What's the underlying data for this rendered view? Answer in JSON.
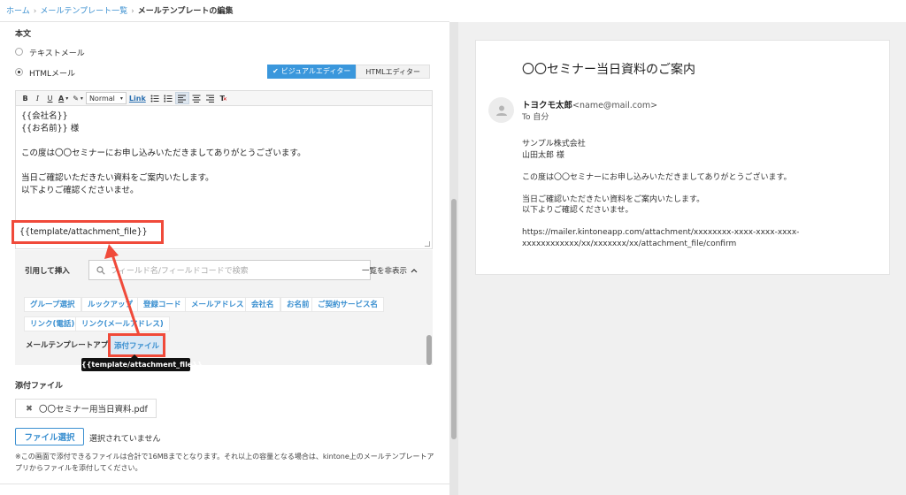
{
  "breadcrumb": {
    "home": "ホーム",
    "list": "メールテンプレート一覧",
    "current": "メールテンプレートの編集"
  },
  "body_section": {
    "label": "本文",
    "radio_text": "テキストメール",
    "radio_html": "HTMLメール",
    "selected": "HTMLメール",
    "tab_visual": "ビジュアルエディター",
    "tab_html": "HTMLエディター",
    "toolbar": {
      "bold": "B",
      "italic": "I",
      "underline": "U",
      "font_color": "A",
      "format": "Normal",
      "link": "Link",
      "clear": "T"
    },
    "editor_lines": [
      "{{会社名}}",
      "{{お名前}} 様",
      "",
      "この度は〇〇セミナーにお申し込みいただきましてありがとうございます。",
      "",
      "当日ご確認いただきたい資料をご案内いたします。",
      "以下よりご確認くださいませ。"
    ],
    "placeholder": "{{template/attachment_file}}"
  },
  "insert_panel": {
    "title": "引用して挿入",
    "search_placeholder": "フィールド名/フィールドコードで検索",
    "toggle_label": "一覧を非表示",
    "chips": [
      "グループ選択",
      "ルックアップ",
      "登録コード",
      "メールアドレス",
      "会社名",
      "お名前",
      "ご契約サービス名",
      "リンク(電話)",
      "リンク(メールアドレス)"
    ],
    "mail_template_label": "メールテンプレートアプリ",
    "attachment_chip": "添付ファイル",
    "tooltip": "{{template/attachment_file}}"
  },
  "attachment": {
    "label": "添付ファイル",
    "file_name": "〇〇セミナー用当日資料.pdf",
    "select_button": "ファイル選択",
    "status": "選択されていません",
    "note_line1": "※この画面で添付できるファイルは合計で16MBまでとなります。それ以上の容量となる場合は、kintone上のメールテンプレートア",
    "note_line2": "プリからファイルを添付してください。"
  },
  "preview": {
    "subject": "〇〇セミナー当日資料のご案内",
    "sender_name": "トヨクモ太郎",
    "sender_email": "<name@mail.com>",
    "to": "To 自分",
    "body_lines": [
      "サンプル株式会社",
      "山田太郎 様",
      "",
      "この度は〇〇セミナーにお申し込みいただきましてありがとうございます。",
      "",
      "当日ご確認いただきたい資料をご案内いたします。",
      "以下よりご確認くださいませ。",
      "",
      "https://mailer.kintoneapp.com/attachment/xxxxxxxx-xxxx-xxxx-xxxx-",
      "xxxxxxxxxxxx/xx/xxxxxxx/xx/attachment_file/confirm"
    ]
  },
  "colors": {
    "accent": "#3a97dc",
    "highlight": "#f04a3a",
    "link": "#3a8fd0"
  }
}
